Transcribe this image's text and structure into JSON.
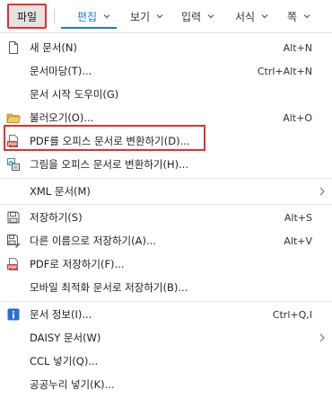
{
  "menubar": {
    "file_label": "파일",
    "tabs": [
      {
        "label": "편집",
        "active": true
      },
      {
        "label": "보기"
      },
      {
        "label": "입력"
      },
      {
        "label": "서식"
      },
      {
        "label": "쪽"
      }
    ],
    "accent_color": "#1a7ad6",
    "highlight_color": "#e53030"
  },
  "menu": {
    "items": [
      {
        "label": "새 문서(N)",
        "shortcut": "Alt+N",
        "icon": "new-document-icon"
      },
      {
        "label": "문서마당(T)...",
        "shortcut": "Ctrl+Alt+N"
      },
      {
        "label": "문서 시작 도우미(G)",
        "shortcut": ""
      },
      {
        "label": "불러오기(O)...",
        "shortcut": "Alt+O",
        "icon": "folder-open-icon"
      },
      {
        "label": "PDF를 오피스 문서로 변환하기(D)...",
        "shortcut": "",
        "icon": "pdf-icon"
      },
      {
        "label": "그림을 오피스 문서로 변환하기(H)...",
        "shortcut": "",
        "icon": "image-convert-icon"
      },
      {
        "label": "XML 문서(M)",
        "shortcut": "",
        "submenu": true
      },
      {
        "label": "저장하기(S)",
        "shortcut": "Alt+S",
        "icon": "save-icon"
      },
      {
        "label": "다른 이름으로 저장하기(A)...",
        "shortcut": "Alt+V",
        "icon": "save-as-icon"
      },
      {
        "label": "PDF로 저장하기(F)...",
        "shortcut": "",
        "icon": "pdf-save-icon"
      },
      {
        "label": "모바일 최적화 문서로 저장하기(B)...",
        "shortcut": ""
      },
      {
        "label": "문서 정보(I)...",
        "shortcut": "Ctrl+Q,I",
        "icon": "info-icon"
      },
      {
        "label": "DAISY 문서(W)",
        "shortcut": "",
        "submenu": true
      },
      {
        "label": "CCL 넣기(Q)...",
        "shortcut": ""
      },
      {
        "label": "공공누리 넣기(K)...",
        "shortcut": ""
      }
    ]
  }
}
